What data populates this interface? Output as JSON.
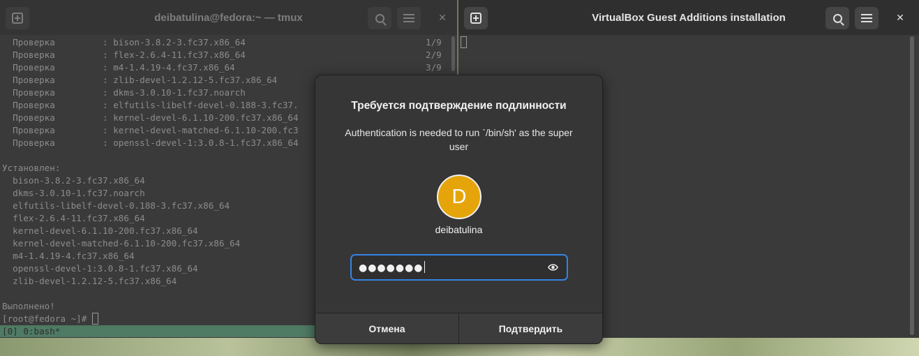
{
  "left_terminal": {
    "title": "deibatulina@fedora:~ — tmux",
    "check_lines": [
      {
        "text": "  Проверка         : bison-3.8.2-3.fc37.x86_64",
        "num": "1/9"
      },
      {
        "text": "  Проверка         : flex-2.6.4-11.fc37.x86_64",
        "num": "2/9"
      },
      {
        "text": "  Проверка         : m4-1.4.19-4.fc37.x86_64",
        "num": "3/9"
      },
      {
        "text": "  Проверка         : zlib-devel-1.2.12-5.fc37.x86_64",
        "num": ""
      },
      {
        "text": "  Проверка         : dkms-3.0.10-1.fc37.noarch",
        "num": ""
      },
      {
        "text": "  Проверка         : elfutils-libelf-devel-0.188-3.fc37.",
        "num": ""
      },
      {
        "text": "  Проверка         : kernel-devel-6.1.10-200.fc37.x86_64",
        "num": ""
      },
      {
        "text": "  Проверка         : kernel-devel-matched-6.1.10-200.fc3",
        "num": ""
      },
      {
        "text": "  Проверка         : openssl-devel-1:3.0.8-1.fc37.x86_64",
        "num": ""
      }
    ],
    "installed_header": "Установлен:",
    "installed": [
      "  bison-3.8.2-3.fc37.x86_64",
      "  dkms-3.0.10-1.fc37.noarch",
      "  elfutils-libelf-devel-0.188-3.fc37.x86_64",
      "  flex-2.6.4-11.fc37.x86_64",
      "  kernel-devel-6.1.10-200.fc37.x86_64",
      "  kernel-devel-matched-6.1.10-200.fc37.x86_64",
      "  m4-1.4.19-4.fc37.x86_64",
      "  openssl-devel-1:3.0.8-1.fc37.x86_64",
      "  zlib-devel-1.2.12-5.fc37.x86_64"
    ],
    "done": "Выполнено!",
    "prompt": "[root@fedora ~]# ",
    "status_bar": "[0] 0:bash*"
  },
  "right_terminal": {
    "title": "VirtualBox Guest Additions installation"
  },
  "dialog": {
    "title": "Требуется подтверждение подлинности",
    "message": "Authentication is needed to run `/bin/sh' as the super user",
    "avatar_letter": "D",
    "avatar_color": "#e5a50a",
    "username": "deibatulina",
    "password_masked": "●●●●●●●",
    "cancel_label": "Отмена",
    "confirm_label": "Подтвердить",
    "focus_color": "#3584e4"
  },
  "icons": {
    "new_tab": "new-tab-icon",
    "search": "search-icon",
    "menu": "hamburger-menu-icon",
    "close": "close-icon",
    "reveal": "eye-icon"
  }
}
